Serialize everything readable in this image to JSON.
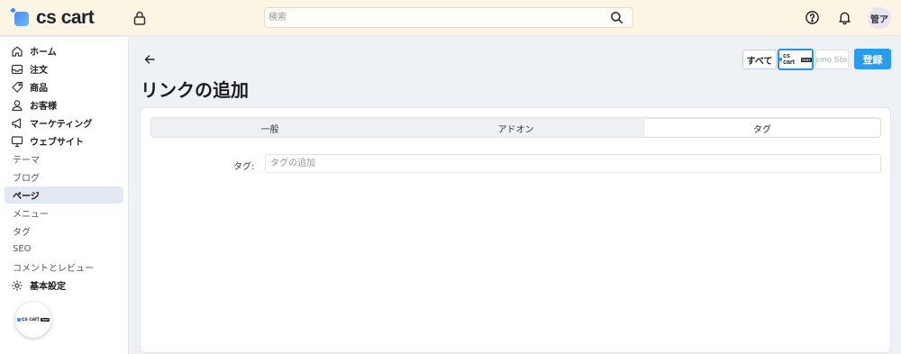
{
  "header": {
    "logo_text": "cs cart",
    "search_placeholder": "検索",
    "avatar_initials": "管ア"
  },
  "sidebar": {
    "items": [
      {
        "label": "ホーム",
        "icon": "home-icon",
        "type": "main"
      },
      {
        "label": "注文",
        "icon": "inbox-icon",
        "type": "main"
      },
      {
        "label": "商品",
        "icon": "tag-icon",
        "type": "main"
      },
      {
        "label": "お客様",
        "icon": "user-icon",
        "type": "main"
      },
      {
        "label": "マーケティング",
        "icon": "megaphone-icon",
        "type": "main"
      },
      {
        "label": "ウェブサイト",
        "icon": "monitor-icon",
        "type": "main"
      },
      {
        "label": "テーマ",
        "type": "sub"
      },
      {
        "label": "ブログ",
        "type": "sub"
      },
      {
        "label": "ページ",
        "type": "sub",
        "active": true
      },
      {
        "label": "メニュー",
        "type": "sub"
      },
      {
        "label": "タグ",
        "type": "sub"
      },
      {
        "label": "SEO",
        "type": "sub"
      },
      {
        "label": "コメントとレビュー",
        "type": "sub"
      },
      {
        "label": "基本設定",
        "icon": "gear-icon",
        "type": "main"
      }
    ],
    "store_logo": {
      "text": "cs cart",
      "tag": "TEST"
    }
  },
  "toolbar": {
    "all_label": "すべて",
    "store1": {
      "text": "cs cart",
      "tag": "TEST"
    },
    "store2_label": "Demo Store",
    "save_label": "登録"
  },
  "page": {
    "title": "リンクの追加"
  },
  "tabs": [
    {
      "label": "一般",
      "active": false
    },
    {
      "label": "アドオン",
      "active": false
    },
    {
      "label": "タグ",
      "active": true
    }
  ],
  "form": {
    "tag_label": "タグ:",
    "tag_placeholder": "タグの追加",
    "tag_value": ""
  },
  "colors": {
    "header_bg": "#fdf5e4",
    "accent": "#2a9cf0",
    "active_nav_bg": "#e3e9f3"
  }
}
